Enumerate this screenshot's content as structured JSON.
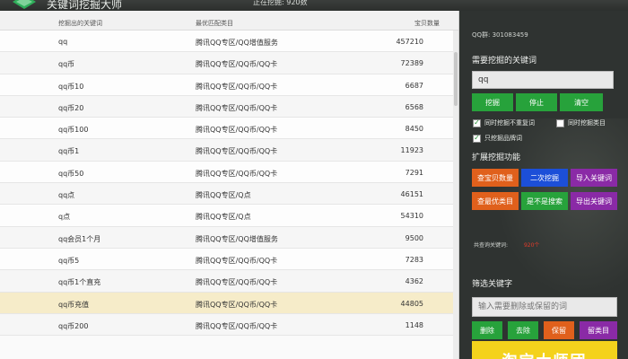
{
  "app": {
    "title": "关键词挖掘大师",
    "status": "正在挖掘: 920数"
  },
  "table": {
    "headers": {
      "keyword": "挖掘出的关键词",
      "category": "最优匹配类目",
      "count": "宝贝数量"
    },
    "rows": [
      {
        "keyword": "qq",
        "category": "腾讯QQ专区/QQ增值服务",
        "count": "457210"
      },
      {
        "keyword": "qq币",
        "category": "腾讯QQ专区/QQ币/QQ卡",
        "count": "72389"
      },
      {
        "keyword": "qq币10",
        "category": "腾讯QQ专区/QQ币/QQ卡",
        "count": "6687"
      },
      {
        "keyword": "qq币20",
        "category": "腾讯QQ专区/QQ币/QQ卡",
        "count": "6568"
      },
      {
        "keyword": "qq币100",
        "category": "腾讯QQ专区/QQ币/QQ卡",
        "count": "8450"
      },
      {
        "keyword": "qq币1",
        "category": "腾讯QQ专区/QQ币/QQ卡",
        "count": "11923"
      },
      {
        "keyword": "qq币50",
        "category": "腾讯QQ专区/QQ币/QQ卡",
        "count": "7291"
      },
      {
        "keyword": "qq点",
        "category": "腾讯QQ专区/Q点",
        "count": "46151"
      },
      {
        "keyword": "q点",
        "category": "腾讯QQ专区/Q点",
        "count": "54310"
      },
      {
        "keyword": "qq会员1个月",
        "category": "腾讯QQ专区/QQ增值服务",
        "count": "9500"
      },
      {
        "keyword": "qq币5",
        "category": "腾讯QQ专区/QQ币/QQ卡",
        "count": "7283"
      },
      {
        "keyword": "qq币1个直充",
        "category": "腾讯QQ专区/QQ币/QQ卡",
        "count": "4362"
      },
      {
        "keyword": "qq币充值",
        "category": "腾讯QQ专区/QQ币/QQ卡",
        "count": "44805"
      },
      {
        "keyword": "qq币200",
        "category": "腾讯QQ专区/QQ币/QQ卡",
        "count": "1148"
      }
    ],
    "selected_row": 12
  },
  "panel": {
    "qq_line": "QQ群: 301083459",
    "need_title": "需要挖掘的关键词",
    "keyword_value": "qq",
    "btn_mine": "挖掘",
    "btn_stop": "停止",
    "btn_clear": "清空",
    "check1": "同时挖掘不重复词",
    "check2": "同时挖掘类目",
    "check3": "只挖掘品牌词",
    "expand_title": "扩展挖掘功能",
    "btn_count": "查宝贝数量",
    "btn_second": "二次挖掘",
    "btn_import": "导入关键词",
    "btn_category": "查最优类目",
    "btn_filter_dup": "是不是搜索",
    "btn_export": "导出关键词",
    "total_label": "共查询关键词:",
    "total_value": "920个",
    "filter_title": "筛选关键字",
    "filter_placeholder": "输入需要删除或保留的词",
    "btn_delete": "删除",
    "btn_remove": "去除",
    "btn_keep": "保留",
    "btn_keep_cat": "留类目",
    "banner": "淘宝大师团"
  },
  "colors": {
    "green": "#27a23b",
    "orange": "#e0601c",
    "blue": "#1c4fd8",
    "purple": "#8a2aa6",
    "banner": "#f4d21c",
    "selected_row": "#f6ecc9"
  }
}
